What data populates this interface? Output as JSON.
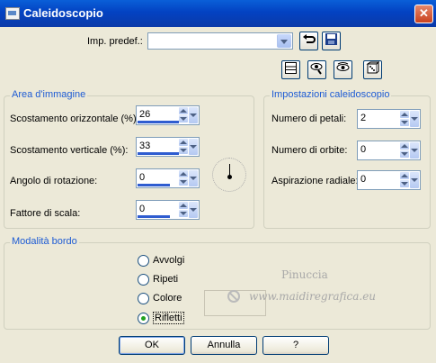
{
  "window": {
    "title": "Caleidoscopio",
    "close_symbol": "✕"
  },
  "preset": {
    "label": "Imp. predef.:",
    "value": ""
  },
  "area": {
    "title": "Area d'immagine",
    "h_offset_label": "Scostamento orizzontale (%):",
    "h_offset_value": "26",
    "v_offset_label": "Scostamento verticale (%):",
    "v_offset_value": "33",
    "rotation_label": "Angolo di rotazione:",
    "rotation_value": "0",
    "scale_label": "Fattore di scala:",
    "scale_value": "0"
  },
  "kaleido": {
    "title": "Impostazioni caleidoscopio",
    "petals_label": "Numero di petali:",
    "petals_value": "2",
    "orbits_label": "Numero di orbite:",
    "orbits_value": "0",
    "radial_label": "Aspirazione radiale:",
    "radial_value": "0"
  },
  "edge": {
    "title": "Modalità bordo",
    "options": [
      "Avvolgi",
      "Ripeti",
      "Colore",
      "Rifletti"
    ],
    "selected": "Rifletti"
  },
  "watermark": {
    "line1": "Pinuccia",
    "line2": "www.maidiregrafica.eu"
  },
  "buttons": {
    "ok": "OK",
    "cancel": "Annulla",
    "help": "?"
  }
}
